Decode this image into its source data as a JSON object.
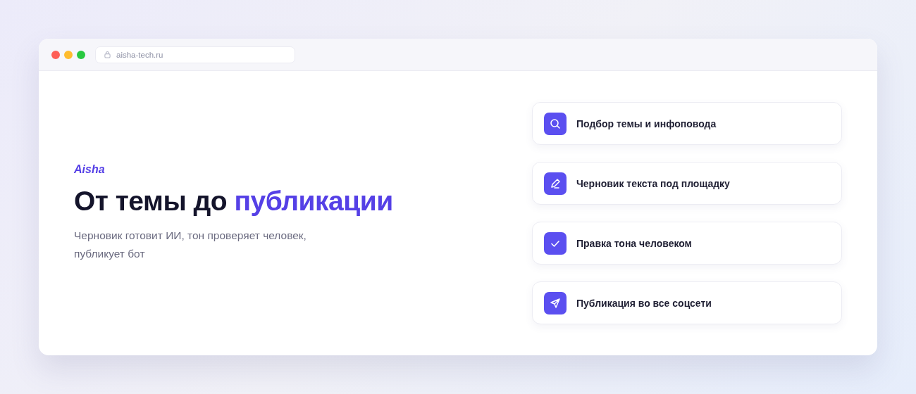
{
  "browser": {
    "address": "aisha-tech.ru"
  },
  "hero": {
    "brand": "Aisha",
    "title": "От темы до",
    "title_accent": "публикации",
    "subtitle": "Черновик готовит ИИ, тон проверяет человек, публикует бот"
  },
  "steps": [
    {
      "kind": "search",
      "label": "Подбор темы и инфоповода"
    },
    {
      "kind": "pen",
      "label": "Черновик текста под площадку"
    },
    {
      "kind": "check",
      "label": "Правка тона человеком"
    },
    {
      "kind": "send",
      "label": "Публикация во все соцсети"
    }
  ]
}
